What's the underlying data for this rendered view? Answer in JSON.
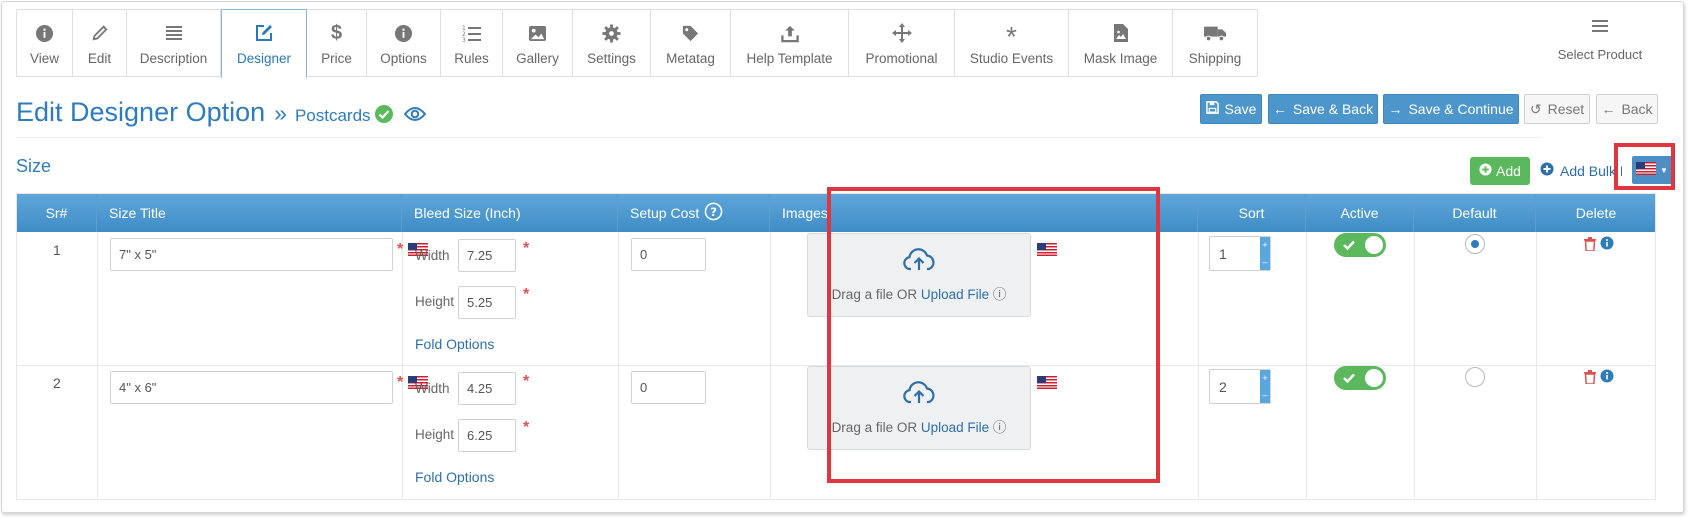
{
  "tabs": [
    {
      "label": "View",
      "icon": "info-icon"
    },
    {
      "label": "Edit",
      "icon": "pencil-icon"
    },
    {
      "label": "Description",
      "icon": "lines-icon"
    },
    {
      "label": "Designer",
      "icon": "edit-square-icon",
      "active": true
    },
    {
      "label": "Price",
      "icon": "dollar-icon"
    },
    {
      "label": "Options",
      "icon": "info-icon"
    },
    {
      "label": "Rules",
      "icon": "numbered-list-icon"
    },
    {
      "label": "Gallery",
      "icon": "image-icon"
    },
    {
      "label": "Settings",
      "icon": "gear-icon"
    },
    {
      "label": "Metatag",
      "icon": "tag-icon"
    },
    {
      "label": "Help Template",
      "icon": "upload-icon"
    },
    {
      "label": "Promotional",
      "icon": "move-arrows-icon"
    },
    {
      "label": "Studio Events",
      "icon": "asterisk-icon"
    },
    {
      "label": "Mask Image",
      "icon": "file-image-icon"
    },
    {
      "label": "Shipping",
      "icon": "truck-icon"
    }
  ],
  "select_product": "Select Product",
  "page": {
    "title": "Edit Designer Option",
    "separator": "»",
    "subtitle": "Postcards"
  },
  "buttons": {
    "save": "Save",
    "save_back": "Save & Back",
    "save_continue": "Save & Continue",
    "reset": "Reset",
    "back": "Back"
  },
  "section": {
    "title": "Size",
    "add": "Add",
    "add_bulk": "Add Bulk Data"
  },
  "table": {
    "headers": {
      "sr": "Sr#",
      "size_title": "Size Title",
      "bleed": "Bleed Size (Inch)",
      "setup_cost": "Setup Cost",
      "images": "Images",
      "sort": "Sort",
      "active": "Active",
      "default": "Default",
      "delete": "Delete"
    },
    "labels": {
      "width": "Width",
      "height": "Height",
      "fold": "Fold Options",
      "drag": "Drag a file OR",
      "upload": "Upload File"
    },
    "rows": [
      {
        "sr": "1",
        "title": "7\" x 5\"",
        "width": "7.25",
        "height": "5.25",
        "setup_cost": "0",
        "sort": "1",
        "active": true,
        "default": true
      },
      {
        "sr": "2",
        "title": "4\" x 6\"",
        "width": "4.25",
        "height": "6.25",
        "setup_cost": "0",
        "sort": "2",
        "active": true,
        "default": false
      }
    ]
  },
  "colors": {
    "accent": "#2f7cbd",
    "button": "#4d96cb",
    "success": "#5cb85c",
    "highlight": "#e0363f",
    "danger": "#d9534f"
  }
}
